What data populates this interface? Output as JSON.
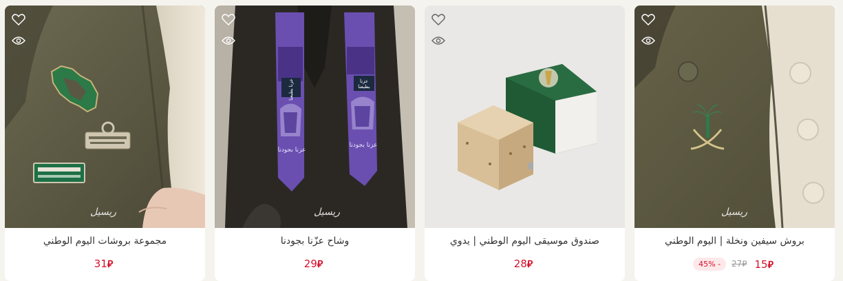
{
  "currency_symbol": "⃁",
  "watermark": "ريسيل",
  "products": [
    {
      "title": "بروش سيفين ونخلة | اليوم الوطني",
      "price": "15",
      "old_price": "27",
      "discount": "45% -",
      "image_label": "خنجر-نخلة-بروش"
    },
    {
      "title": "صندوق موسيقى اليوم الوطني | يدوي",
      "price": "28",
      "image_label": "صندوق-موسيقى"
    },
    {
      "title": "وشاح عزّنا بجودنا",
      "price": "29",
      "image_label": "وشاح",
      "scarf_text_1": "عزنا بطبعنا",
      "scarf_text_2": "عزنا بجودنا"
    },
    {
      "title": "مجموعة بروشات اليوم الوطني",
      "price": "31",
      "image_label": "مجموعة-بروشات"
    }
  ]
}
